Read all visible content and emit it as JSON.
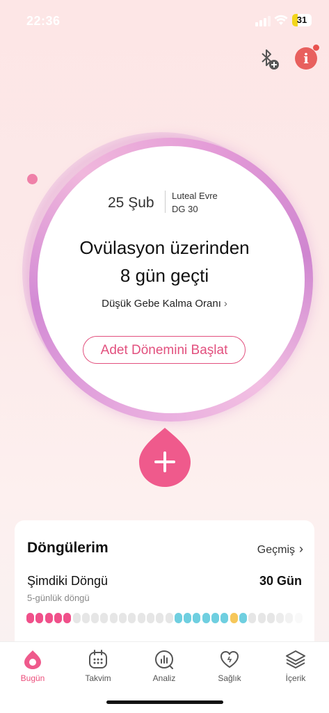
{
  "status_bar": {
    "time": "22:36",
    "battery": "31"
  },
  "today": {
    "date": "25 Şub",
    "phase": "Luteal Evre",
    "cycle_day": "DG 30",
    "headline_line1": "Ovülasyon üzerinden",
    "headline_line2": "8 gün geçti",
    "pregnancy_chance": "Düşük Gebe Kalma Oranı",
    "start_period_button": "Adet Dönemini Başlat"
  },
  "cycles_card": {
    "title": "Döngülerim",
    "history_link": "Geçmiş",
    "current_label": "Şimdiki Döngü",
    "current_length": "30 Gün",
    "period_length": "5-günlük döngü",
    "day_colors": {
      "period": "#f0508a",
      "normal": "#e6e6e6",
      "fertile": "#6fcfe0",
      "ovulation": "#f6c75a"
    },
    "day_types": [
      "period",
      "period",
      "period",
      "period",
      "period",
      "normal",
      "normal",
      "normal",
      "normal",
      "normal",
      "normal",
      "normal",
      "normal",
      "normal",
      "normal",
      "normal",
      "fertile",
      "fertile",
      "fertile",
      "fertile",
      "fertile",
      "fertile",
      "ovulation",
      "fertile",
      "normal",
      "normal",
      "normal",
      "normal",
      "normal",
      "normal"
    ]
  },
  "tabs": [
    {
      "label": "Bugün",
      "icon": "drop-icon",
      "active": true
    },
    {
      "label": "Takvim",
      "icon": "calendar-icon",
      "active": false
    },
    {
      "label": "Analiz",
      "icon": "analysis-icon",
      "active": false
    },
    {
      "label": "Sağlık",
      "icon": "heart-icon",
      "active": false
    },
    {
      "label": "İçerik",
      "icon": "layers-icon",
      "active": false
    }
  ],
  "colors": {
    "accent": "#ec4f7c",
    "info": "#e8605e"
  }
}
